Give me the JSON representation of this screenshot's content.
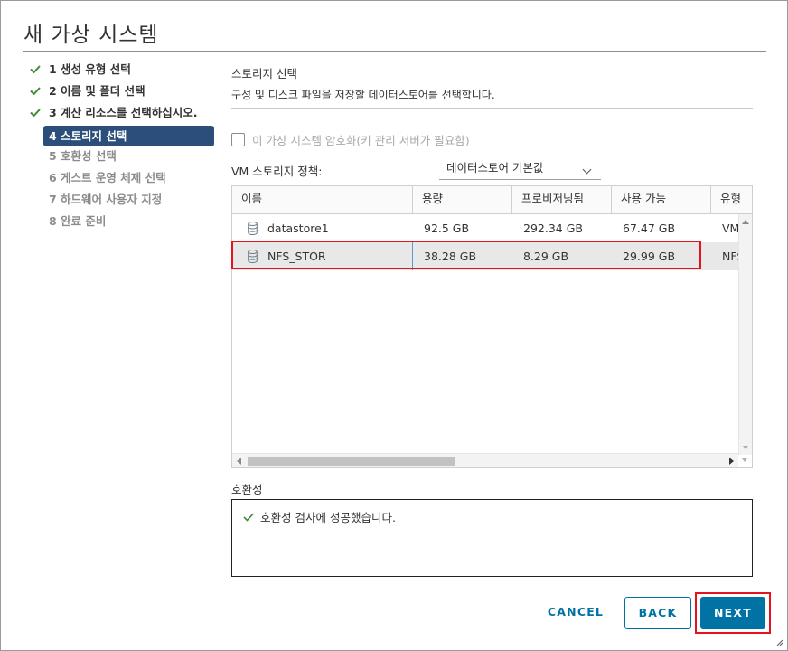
{
  "dialog": {
    "title": "새 가상 시스템"
  },
  "steps": [
    {
      "label": "1 생성 유형 선택",
      "state": "done"
    },
    {
      "label": "2 이름 및 폴더 선택",
      "state": "done"
    },
    {
      "label": "3 계산 리소스를 선택하십시오.",
      "state": "done"
    },
    {
      "label": "4 스토리지 선택",
      "state": "active"
    },
    {
      "label": "5 호환성 선택",
      "state": "pending"
    },
    {
      "label": "6 게스트 운영 체제 선택",
      "state": "pending"
    },
    {
      "label": "7 하드웨어 사용자 지정",
      "state": "pending"
    },
    {
      "label": "8 완료 준비",
      "state": "pending"
    }
  ],
  "storage": {
    "title": "스토리지 선택",
    "description": "구성 및 디스크 파일을 저장할 데이터스토어를 선택합니다.",
    "encrypt_label": "이 가상 시스템 암호화(키 관리 서버가 필요함)",
    "policy_label": "VM 스토리지 정책:",
    "policy_value": "데이터스토어 기본값"
  },
  "grid": {
    "columns": [
      "이름",
      "용량",
      "프로비저닝됨",
      "사용 가능",
      "유형"
    ],
    "rows": [
      {
        "name": "datastore1",
        "capacity": "92.5 GB",
        "provisioned": "292.34 GB",
        "free": "67.47 GB",
        "type": "VMFS"
      },
      {
        "name": "NFS_STOR",
        "capacity": "38.28 GB",
        "provisioned": "8.29 GB",
        "free": "29.99 GB",
        "type": "NFS"
      }
    ]
  },
  "compat": {
    "label": "호환성",
    "message": "호환성 검사에 성공했습니다."
  },
  "buttons": {
    "cancel": "CANCEL",
    "back": "BACK",
    "next": "NEXT"
  },
  "colors": {
    "accent": "#0072a3",
    "active_step": "#2b4f7a",
    "success": "#3d8b37",
    "highlight": "#e3141e"
  }
}
